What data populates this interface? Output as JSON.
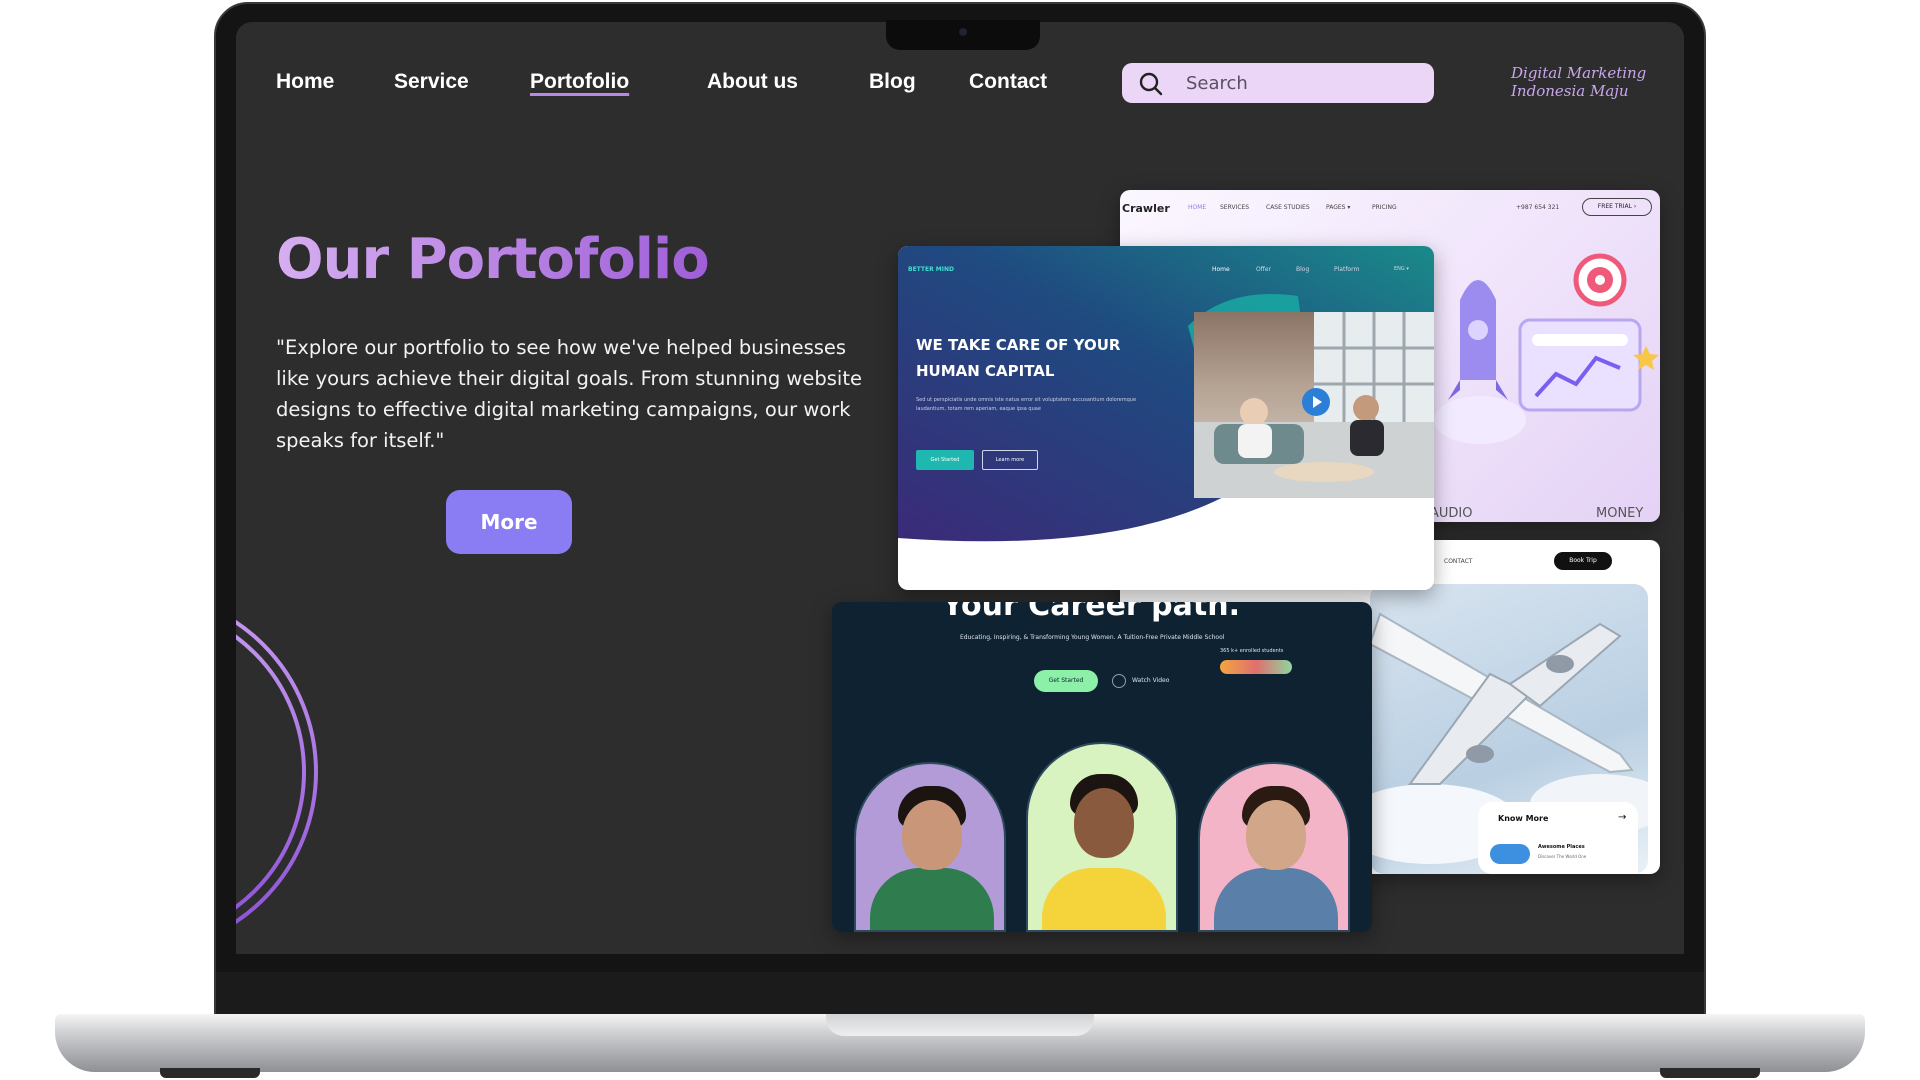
{
  "nav": {
    "items": [
      {
        "label": "Home"
      },
      {
        "label": "Service"
      },
      {
        "label": "Portofolio",
        "active": true
      },
      {
        "label": "About us"
      },
      {
        "label": "Blog"
      },
      {
        "label": "Contact"
      }
    ],
    "search_placeholder": "Search",
    "search_icon": "search-icon",
    "brand_line1": "Digital Marketing",
    "brand_line2": "Indonesia Maju"
  },
  "hero": {
    "title": "Our Portofolio",
    "text": "\"Explore our portfolio to see how we've helped businesses like yours achieve their digital goals. From stunning website designs to effective digital marketing campaigns, our work speaks for itself.\"",
    "button": "More"
  },
  "portfolio": {
    "crawler": {
      "logo": "Crawler",
      "menu": [
        "HOME",
        "SERVICES",
        "CASE STUDIES",
        "PAGES ▾",
        "PRICING"
      ],
      "phone": "+987 654 321",
      "cta": "FREE TRIAL ›",
      "bottom_left": "AUDIO",
      "bottom_right": "MONEY"
    },
    "better_mind": {
      "logo": "BETTER MIND",
      "menu": [
        "Home",
        "Offer",
        "Blog",
        "Platform"
      ],
      "lang": "ENG ▾",
      "headline_line1": "WE TAKE CARE OF YOUR",
      "headline_line2": "HUMAN CAPITAL",
      "body": "Sed ut perspiciatis unde omnis iste natus error sit voluptatem accusantium doloremque laudantium, totam rem aperiam, eaque ipsa quae",
      "primary": "Get Started",
      "secondary": "Learn more"
    },
    "travel": {
      "menu_item": "CONTACT",
      "cta": "Book Trip",
      "know_more": "Know More",
      "places_title": "Awesome Places",
      "places_sub": "Discover The World One"
    },
    "career": {
      "headline": "Your Career path.",
      "tagline": "Educating, Inspiring, & Transforming Young Women. A Tuition-Free Private Middle School",
      "students": "365 k+ enrolled students",
      "primary": "Get Started",
      "video": "Watch Video"
    }
  },
  "colors": {
    "screen_bg": "#2d2d2d",
    "accent_purple": "#8a7cf2",
    "title_gradient_start": "#d6aef0",
    "title_gradient_end": "#9f5ed8",
    "search_bg": "#ecd6f8"
  }
}
